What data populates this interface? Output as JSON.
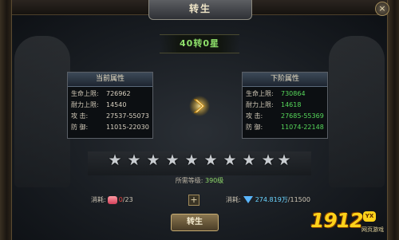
{
  "window": {
    "title": "转生",
    "close": "×"
  },
  "rank": {
    "label": "40转0星"
  },
  "current": {
    "header": "当前属性",
    "rows": [
      {
        "label": "生命上限:",
        "value": "726962"
      },
      {
        "label": "耐力上限:",
        "value": "14540"
      },
      {
        "label": "攻    击:",
        "value": "27537-55073"
      },
      {
        "label": "防    御:",
        "value": "11015-22030"
      }
    ]
  },
  "next": {
    "header": "下阶属性",
    "rows": [
      {
        "label": "生命上限:",
        "value": "730864"
      },
      {
        "label": "耐力上限:",
        "value": "14618"
      },
      {
        "label": "攻    击:",
        "value": "27685-55369"
      },
      {
        "label": "防    御:",
        "value": "11074-22148"
      }
    ]
  },
  "stars": {
    "total": 10,
    "filled": 0
  },
  "requirement": {
    "label": "所需等级:",
    "value": "390级"
  },
  "cost_left": {
    "label": "消耗:",
    "have": "0",
    "need": "/23"
  },
  "cost_right": {
    "label": "消耗:",
    "amount": "274.819万",
    "need": "/11500"
  },
  "buttons": {
    "plus": "+",
    "confirm": "转生"
  },
  "logo": {
    "number": "1912",
    "badge": "YX",
    "sub": "网页游戏"
  }
}
